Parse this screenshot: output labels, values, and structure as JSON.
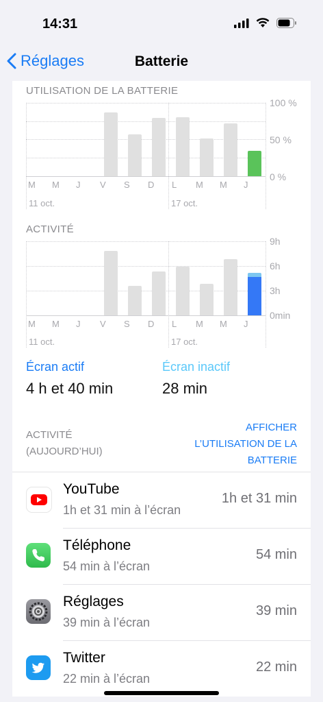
{
  "status_bar": {
    "time": "14:31"
  },
  "nav": {
    "back_label": "Réglages",
    "title": "Batterie"
  },
  "battery_chart": {
    "section_title": "UTILISATION DE LA BATTERIE",
    "y_ticks": [
      "100 %",
      "50 %",
      "0 %"
    ],
    "day_labels": [
      "M",
      "M",
      "J",
      "V",
      "S",
      "D",
      "L",
      "M",
      "M",
      "J"
    ],
    "date_labels": [
      "11 oct.",
      "17 oct."
    ]
  },
  "activity_chart": {
    "section_title": "ACTIVITÉ",
    "y_ticks": [
      "9h",
      "6h",
      "3h",
      "0min"
    ],
    "day_labels": [
      "M",
      "M",
      "J",
      "V",
      "S",
      "D",
      "L",
      "M",
      "M",
      "J"
    ],
    "date_labels": [
      "11 oct.",
      "17 oct."
    ]
  },
  "chart_data": [
    {
      "type": "bar",
      "title": "UTILISATION DE LA BATTERIE",
      "categories": [
        "M",
        "M",
        "J",
        "V",
        "S",
        "D",
        "L",
        "M",
        "M",
        "J"
      ],
      "values": [
        0,
        0,
        0,
        87,
        57,
        79,
        80,
        51,
        72,
        35
      ],
      "ylim": [
        0,
        100
      ],
      "colors": {
        "default": "#e0e0e0",
        "highlight": "#5ac35a"
      }
    },
    {
      "type": "bar",
      "title": "ACTIVITÉ",
      "categories": [
        "M",
        "M",
        "J",
        "V",
        "S",
        "D",
        "L",
        "M",
        "M",
        "J"
      ],
      "series": [
        {
          "values": [
            0,
            0,
            0,
            7.8,
            3.6,
            5.3,
            5.9,
            3.8,
            6.8,
            4.7
          ]
        },
        {
          "values": [
            0,
            0,
            0,
            0,
            0,
            0,
            0,
            0,
            0,
            0.5
          ]
        }
      ],
      "ylim": [
        0,
        9
      ],
      "colors": {
        "default": "#e0e0e0",
        "screen_on": "#3478f6",
        "screen_off": "#7dc6f0"
      }
    }
  ],
  "legend": {
    "on_label": "Écran actif",
    "on_value": "4 h et 40 min",
    "off_label": "Écran inactif",
    "off_value": "28 min",
    "on_color": "#1a7cf5",
    "off_color": "#5ac8fa"
  },
  "activity_section": {
    "header_line1": "ACTIVITÉ",
    "header_line2": "(AUJOURD’HUI)",
    "link_line1": "AFFICHER",
    "link_line2": "L’UTILISATION DE LA",
    "link_line3": "BATTERIE"
  },
  "apps": [
    {
      "name": "YouTube",
      "detail": "1h et 31 min à l’écran",
      "time": "1h et 31 min",
      "icon": "youtube-icon",
      "color": "#ff0000"
    },
    {
      "name": "Téléphone",
      "detail": "54 min à l’écran",
      "time": "54 min",
      "icon": "phone-icon",
      "color": "#34c759"
    },
    {
      "name": "Réglages",
      "detail": "39 min à l’écran",
      "time": "39 min",
      "icon": "settings-icon",
      "color": "#8e8e93"
    },
    {
      "name": "Twitter",
      "detail": "22 min à l’écran",
      "time": "22 min",
      "icon": "twitter-icon",
      "color": "#1d9bf0"
    }
  ]
}
